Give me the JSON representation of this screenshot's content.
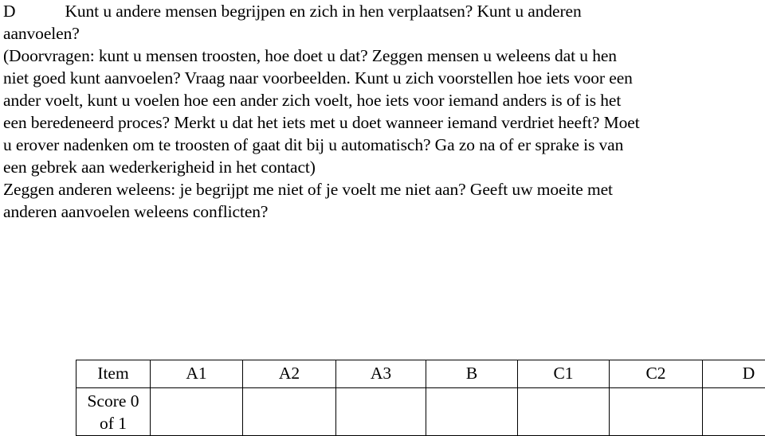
{
  "document": {
    "question": {
      "letter": "D",
      "lines": [
        "Kunt u andere mensen begrijpen en zich in hen verplaatsen? Kunt u anderen",
        "aanvoelen?",
        "(Doorvragen: kunt u mensen troosten, hoe doet u dat? Zeggen mensen u weleens dat u hen",
        "niet goed kunt aanvoelen? Vraag naar voorbeelden. Kunt u zich voorstellen hoe iets voor een",
        "ander voelt, kunt u voelen hoe een ander zich voelt, hoe iets voor iemand anders is of is het",
        "een beredeneerd proces? Merkt u dat het iets met u doet wanneer iemand verdriet heeft? Moet",
        "u erover nadenken om te troosten of gaat dit bij u automatisch? Ga zo na of er sprake is van",
        "een gebrek aan wederkerigheid in het contact)",
        "Zeggen anderen weleens: je begrijpt me niet of je voelt me niet aan? Geeft uw moeite met",
        "anderen aanvoelen weleens conflicten?"
      ]
    },
    "score_table": {
      "headers": [
        "Item",
        "A1",
        "A2",
        "A3",
        "B",
        "C1",
        "C2",
        "D"
      ],
      "rows": [
        {
          "cells": [
            "Score 0\nof 1",
            "",
            "",
            "",
            "",
            "",
            "",
            ""
          ],
          "score_label_line1": "Score 0",
          "score_label_line2": "of 1"
        }
      ]
    }
  }
}
